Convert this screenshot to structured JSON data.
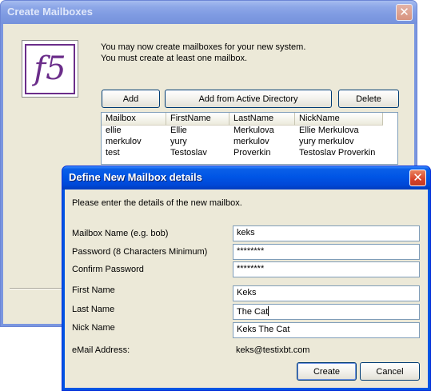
{
  "main_window": {
    "title": "Create Mailboxes",
    "close_glyph": "✕",
    "logo_text": "f5",
    "intro_line1": "You may now create mailboxes for your new system.",
    "intro_line2": "You must create at least one mailbox.",
    "buttons": {
      "add": "Add",
      "add_ad": "Add from Active Directory",
      "delete": "Delete"
    },
    "list": {
      "columns": [
        "Mailbox",
        "FirstName",
        "LastName",
        "NickName"
      ],
      "rows": [
        [
          "ellie",
          "Ellie",
          "Merkulova",
          "Ellie Merkulova"
        ],
        [
          "merkulov",
          "yury",
          "merkulov",
          "yury merkulov"
        ],
        [
          "test",
          "Testoslav",
          "Proverkin",
          "Testoslav Proverkin"
        ]
      ]
    }
  },
  "dialog": {
    "title": "Define New Mailbox details",
    "close_glyph": "✕",
    "intro": "Please enter the details of the new mailbox.",
    "labels": {
      "mailbox_name": "Mailbox Name (e.g. bob)",
      "password": "Password (8 Characters Minimum)",
      "confirm_password": "Confirm Password",
      "first_name": "First Name",
      "last_name": "Last Name",
      "nick_name": "Nick Name",
      "email": "eMail Address:"
    },
    "values": {
      "mailbox_name": "keks",
      "password": "********",
      "confirm_password": "********",
      "first_name": "Keks",
      "last_name": "The Cat",
      "nick_name": "Keks The Cat",
      "email": "keks@testixbt.com"
    },
    "buttons": {
      "create": "Create",
      "cancel": "Cancel"
    }
  },
  "colors": {
    "xp_blue": "#0054e3",
    "client_bg": "#ece9d8",
    "close_red": "#d8432a",
    "logo_purple": "#6b2d8a"
  },
  "icons": {
    "close": "close-icon",
    "logo": "f5-logo"
  }
}
